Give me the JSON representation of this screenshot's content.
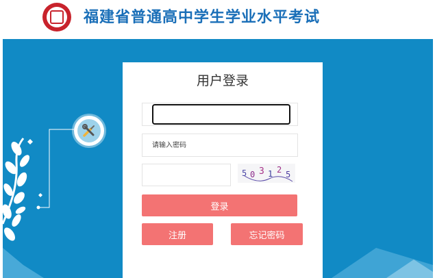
{
  "header": {
    "title": "福建省普通高中学生学业水平考试",
    "logo_icon": "emblem-seal-icon",
    "brand_color": "#1a6fb8",
    "seal_color": "#c8232c"
  },
  "main": {
    "background_color": "#118ac5",
    "decor_icon": "wrench-screwdriver-tools-icon"
  },
  "login": {
    "title": "用户登录",
    "username": {
      "value": "",
      "placeholder": ""
    },
    "password": {
      "value": "",
      "placeholder": "请输入密码"
    },
    "captcha": {
      "value": "",
      "placeholder": "",
      "chars": [
        "5",
        "0",
        "3",
        "1",
        "2",
        "5"
      ],
      "colors": [
        "#4a46a6",
        "#8b2a8a",
        "#a73388",
        "#3b3b9a",
        "#9c2f86",
        "#4a3aa0"
      ]
    },
    "login_label": "登录",
    "register_label": "注册",
    "forgot_label": "忘记密码",
    "button_color": "#f37373"
  }
}
